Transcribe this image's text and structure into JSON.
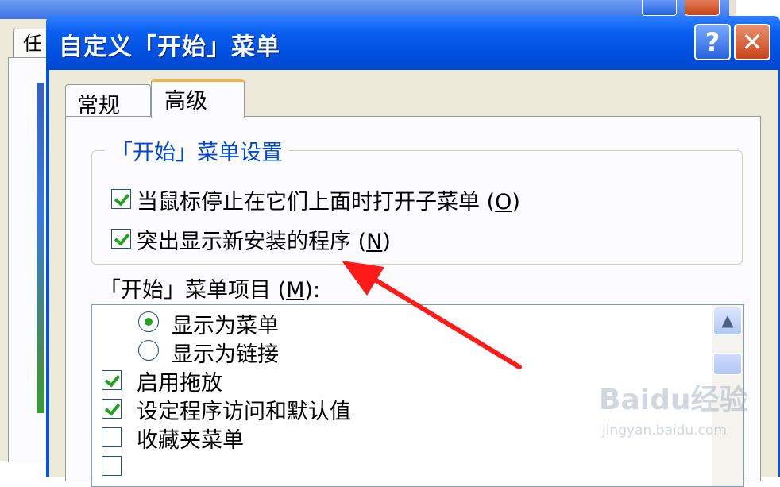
{
  "background_window": {
    "tab_label": "任"
  },
  "dialog": {
    "title": "自定义「开始」菜单",
    "help_label": "?",
    "close_label": "✕",
    "tabs": [
      {
        "label": "常规",
        "selected": false
      },
      {
        "label": "高级",
        "selected": true
      }
    ],
    "start_menu_settings": {
      "title": "「开始」菜单设置",
      "options": [
        {
          "label": "当鼠标停止在它们上面时打开子菜单",
          "key": "O",
          "checked": true
        },
        {
          "label": "突出显示新安装的程序",
          "key": "N",
          "checked": true
        }
      ]
    },
    "items_label": "「开始」菜单项目",
    "items_key": "M",
    "items_suffix": ":",
    "items": [
      {
        "type": "radio",
        "label": "显示为菜单",
        "checked": true
      },
      {
        "type": "radio",
        "label": "显示为链接",
        "checked": false
      },
      {
        "type": "checkbox",
        "label": "启用拖放",
        "checked": true
      },
      {
        "type": "checkbox",
        "label": "设定程序访问和默认值",
        "checked": true
      },
      {
        "type": "checkbox",
        "label": "收藏夹菜单",
        "checked": false
      }
    ]
  },
  "watermark": {
    "logo": "Baidu经验",
    "url": "jingyan.baidu.com"
  },
  "colors": {
    "title_bar": "#0055e5",
    "group_title": "#0046d5",
    "annotation_arrow": "#ff1a1a",
    "check_mark": "#21a121"
  }
}
